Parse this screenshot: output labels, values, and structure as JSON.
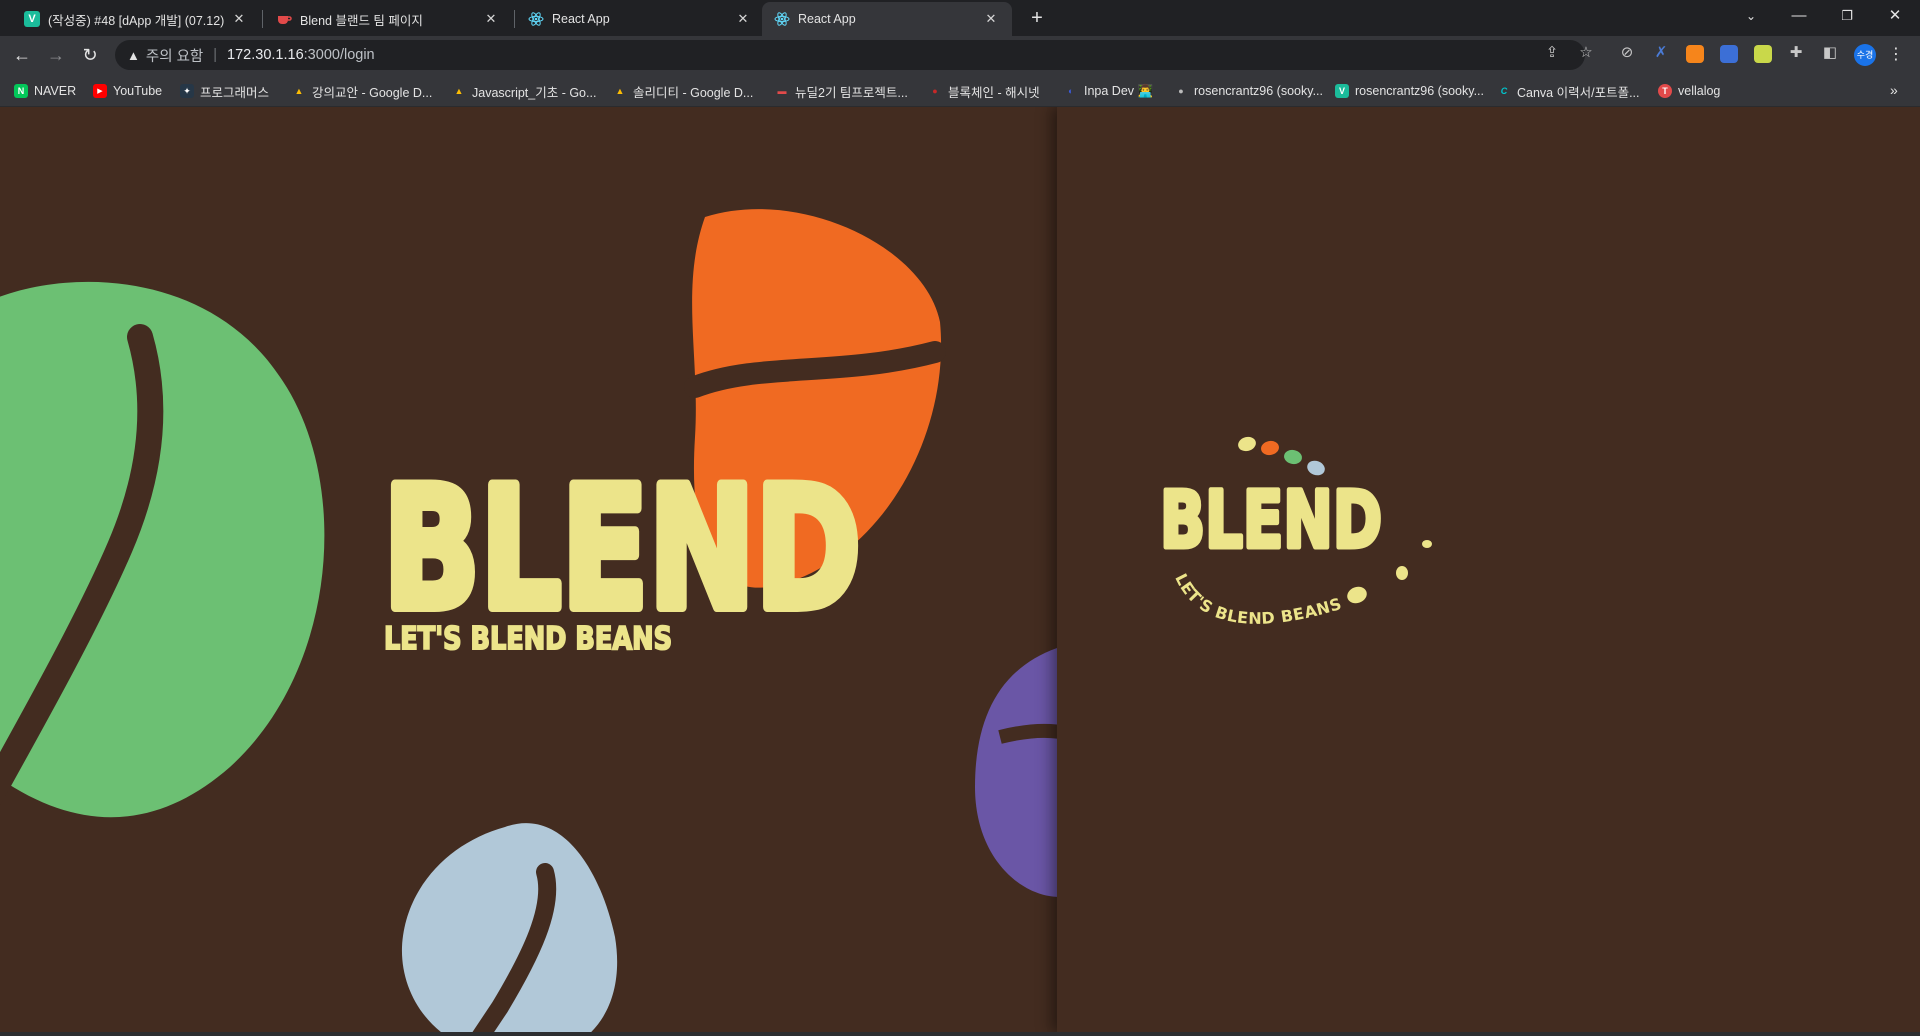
{
  "tabs": [
    {
      "title": "(작성중) #48 [dApp 개발] (07.12)",
      "favicon": "V",
      "favicon_color": "#1bbc9b",
      "active": false
    },
    {
      "title": "Blend 블랜드 팀 페이지",
      "favicon": "cup",
      "favicon_color": "#e24a4a",
      "active": false
    },
    {
      "title": "React App",
      "favicon": "react",
      "favicon_color": "#61dafb",
      "active": false
    },
    {
      "title": "React App",
      "favicon": "react",
      "favicon_color": "#61dafb",
      "active": true
    }
  ],
  "toolbar": {
    "security_label": "주의 요함",
    "url_host": "172.30.1.16",
    "url_path": ":3000/login",
    "avatar_label": "수경"
  },
  "bookmarks": [
    {
      "label": "NAVER",
      "color": "#03c75a",
      "glyph": "N"
    },
    {
      "label": "YouTube",
      "color": "#ff0000",
      "glyph": "▶"
    },
    {
      "label": "프로그래머스",
      "color": "#263747",
      "glyph": "✦"
    },
    {
      "label": "강의교안 - Google D...",
      "color": "#fbbc04",
      "glyph": "▲"
    },
    {
      "label": "Javascript_기초 - Go...",
      "color": "#fbbc04",
      "glyph": "▲"
    },
    {
      "label": "솔리디티 - Google D...",
      "color": "#fbbc04",
      "glyph": "▲"
    },
    {
      "label": "뉴딜2기 팀프로젝트...",
      "color": "#e24a4a",
      "glyph": "▬"
    },
    {
      "label": "블록체인 - 해시넷",
      "color": "#c62828",
      "glyph": "●"
    },
    {
      "label": "Inpa Dev 👨‍💻",
      "color": "#3b5bdb",
      "glyph": "◐"
    },
    {
      "label": "rosencrantz96 (sooky...",
      "color": "#444",
      "glyph": "●"
    },
    {
      "label": "rosencrantz96 (sooky...",
      "color": "#1bbc9b",
      "glyph": "V"
    },
    {
      "label": "Canva 이력서/포트폴...",
      "color": "#00c4cc",
      "glyph": "C"
    },
    {
      "label": "vellalog",
      "color": "#e24a4a",
      "glyph": "T"
    }
  ],
  "hero": {
    "logo_text": "BLEND",
    "tagline": "LET'S BLEND BEANS"
  },
  "panel": {
    "logo_text": "BLEND",
    "tagline": "LET'S BLEND BEANS!"
  },
  "colors": {
    "background": "#432c20",
    "cream": "#ece48a",
    "green_bean": "#6cc073",
    "orange_bean": "#f06a22",
    "purple_bean": "#6a56a6",
    "blue_bean": "#b1c8d8"
  }
}
